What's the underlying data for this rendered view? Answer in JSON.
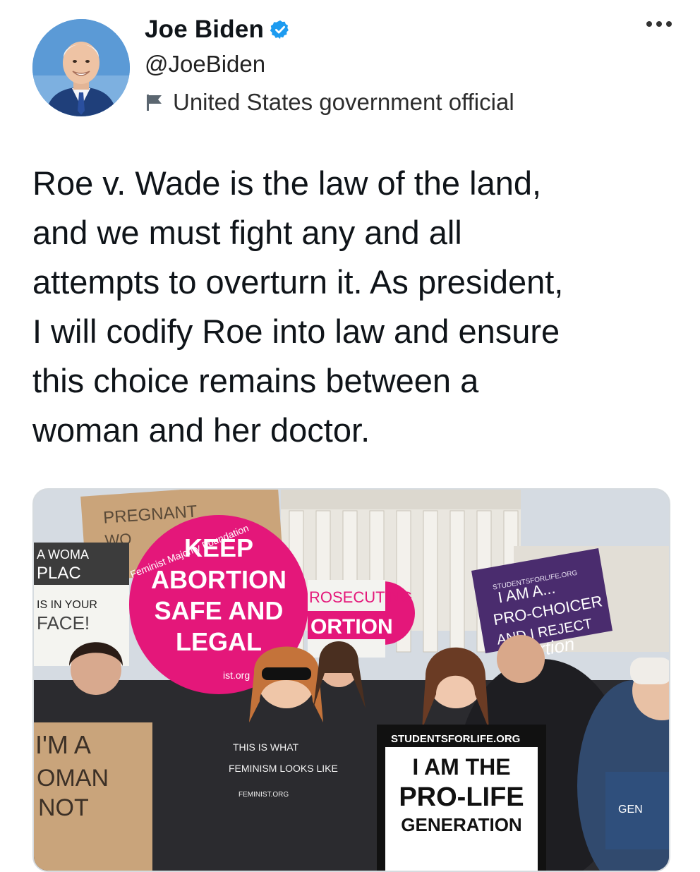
{
  "author": {
    "name": "Joe Biden",
    "handle": "@JoeBiden",
    "label": "United States government official",
    "verified": true,
    "verified_color": "#1d9bf0"
  },
  "tweet": {
    "text": "Roe v. Wade is the law of the land,\nand we must fight any and all\nattempts to overturn it. As president,\nI will codify Roe into law and ensure\nthis choice remains between a\nwoman and her doctor."
  },
  "media": {
    "signs": {
      "pregnant": "PREGNANT",
      "woman_short": "WO",
      "a_woman": "A WOMA",
      "place": "PLAC",
      "is_in_your": "IS IN YOUR",
      "face": "FACE!",
      "feminist_majority": "Feminist Majority Foundation",
      "keep": "KEEP",
      "abortion": "ABORTION",
      "safe_and": "SAFE AND",
      "legal": "LEGAL",
      "ist_org": "ist.org",
      "prosecuting": "ROSECUTING",
      "ortion": "ORTION",
      "students_small": "STUDENTSFORLIFE.ORG",
      "i_am_a": "I AM A...",
      "pro_choicer": "PRO-CHOICER",
      "and_i_reject": "AND I REJECT",
      "ortion_script": "ortion",
      "im_a": "I'M A",
      "oman": "OMAN",
      "not": "NOT",
      "this_is_what": "THIS IS WHAT",
      "feminism_looks_like": "FEMINISM LOOKS LIKE",
      "feminist_org": "FEMINIST.ORG",
      "studentsforlife": "STUDENTSFORLIFE.ORG",
      "i_am_the": "I AM THE",
      "pro_life": "PRO-LIFE",
      "generation": "GENERATION",
      "gen": "GEN"
    }
  }
}
